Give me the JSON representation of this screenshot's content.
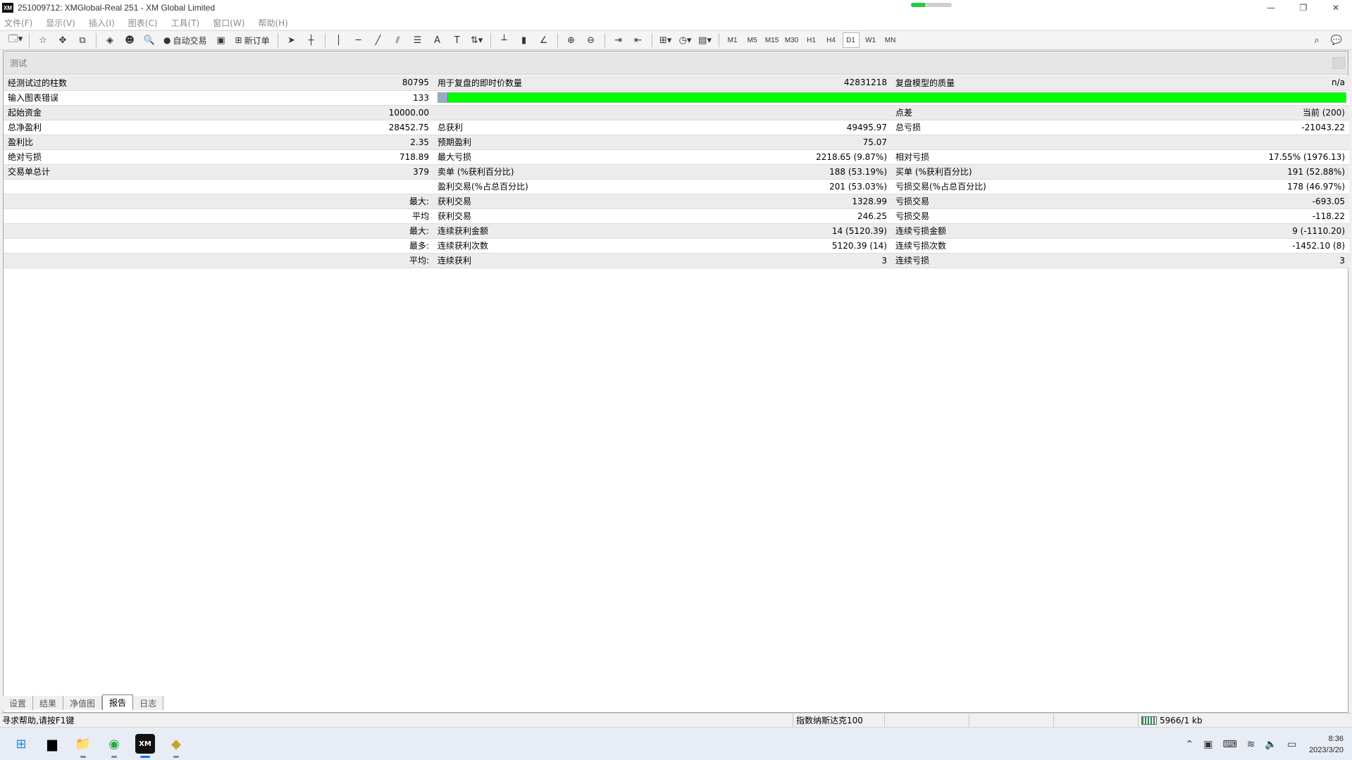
{
  "window": {
    "logo": "XM",
    "title": "251009712: XMGlobal-Real 251 - XM Global Limited",
    "controls": [
      "—",
      "❐",
      "✕"
    ]
  },
  "menu": [
    "文件(F)",
    "显示(V)",
    "插入(I)",
    "图表(C)",
    "工具(T)",
    "窗口(W)",
    "帮助(H)"
  ],
  "toolbar": {
    "auto_trade_label": "自动交易",
    "new_order_label": "新订单",
    "timeframes": [
      "M1",
      "M5",
      "M15",
      "M30",
      "H1",
      "H4",
      "D1",
      "W1",
      "MN"
    ],
    "active_timeframe": "D1"
  },
  "panel": {
    "title": "测试"
  },
  "report": {
    "rows": [
      [
        "经测试过的柱数",
        "80795",
        "用于复盘的即时价数量",
        "42831218",
        "复盘模型的质量",
        "n/a"
      ],
      [
        "输入图表错误",
        "133",
        "",
        "",
        "",
        ""
      ],
      [
        "起始资金",
        "10000.00",
        "",
        "",
        "点差",
        "当前 (200)"
      ],
      [
        "总净盈利",
        "28452.75",
        "总获利",
        "49495.97",
        "总亏损",
        "-21043.22"
      ],
      [
        "盈利比",
        "2.35",
        "预期盈利",
        "75.07",
        "",
        ""
      ],
      [
        "绝对亏损",
        "718.89",
        "最大亏损",
        "2218.65 (9.87%)",
        "相对亏损",
        "17.55% (1976.13)"
      ],
      [
        "交易单总计",
        "379",
        "卖单 (%获利百分比)",
        "188 (53.19%)",
        "买单 (%获利百分比)",
        "191 (52.88%)"
      ],
      [
        "",
        "",
        "盈利交易(%占总百分比)",
        "201 (53.03%)",
        "亏损交易(%占总百分比)",
        "178 (46.97%)"
      ],
      [
        "",
        "最大:",
        "获利交易",
        "1328.99",
        "亏损交易",
        "-693.05"
      ],
      [
        "",
        "平均",
        "获利交易",
        "246.25",
        "亏损交易",
        "-118.22"
      ],
      [
        "",
        "最大:",
        "连续获利金额",
        "14 (5120.39)",
        "连续亏损金额",
        "9 (-1110.20)"
      ],
      [
        "",
        "最多:",
        "连续获利次数",
        "5120.39 (14)",
        "连续亏损次数",
        "-1452.10 (8)"
      ],
      [
        "",
        "平均:",
        "连续获利",
        "3",
        "连续亏损",
        "3"
      ]
    ],
    "quality_bar_color": "#00ff00"
  },
  "tabs": {
    "items": [
      "设置",
      "结果",
      "净值图",
      "报告",
      "日志"
    ],
    "active": "报告"
  },
  "status": {
    "help": "寻求帮助,请按F1键",
    "profile": "指数纳斯达克100",
    "connection": "5966/1 kb"
  },
  "taskbar": {
    "time": "8:36",
    "date": "2023/3/20"
  }
}
